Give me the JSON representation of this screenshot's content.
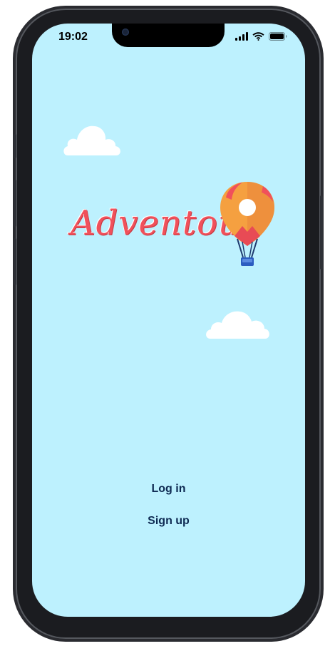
{
  "status_bar": {
    "time": "19:02",
    "icons": [
      "signal-icon",
      "wifi-icon",
      "battery-icon"
    ]
  },
  "app": {
    "logo_text": "Adventour",
    "logo_icon": "hot-air-balloon-location-pin"
  },
  "actions": {
    "login_label": "Log in",
    "signup_label": "Sign up"
  },
  "colors": {
    "screen_background": "#bdf1fe",
    "logo": "#f0515b",
    "action_text": "#0e2a52",
    "balloon_orange": "#f5a040",
    "balloon_red": "#e84b55",
    "basket": "#2b5cc0"
  }
}
